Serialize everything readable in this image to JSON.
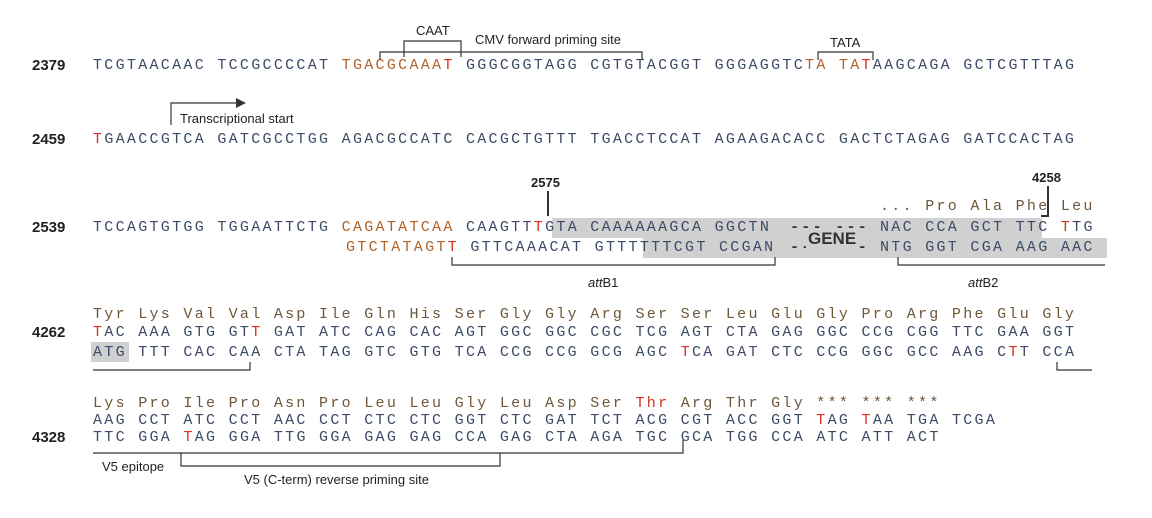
{
  "colors": {
    "blue": "#3c4a66",
    "orange": "#b0622a",
    "red": "#d7301f",
    "amino": "#6e5638",
    "highlight": "#d0d0d0"
  },
  "line_numbers": [
    "2379",
    "2459",
    "2539",
    "4262",
    "4328"
  ],
  "positions": {
    "p1": "2575",
    "p2": "4258"
  },
  "labels": {
    "caat": "CAAT",
    "cmv": "CMV forward priming site",
    "tata": "TATA",
    "tx_start": "Transcriptional start",
    "gene": "GENE",
    "gene_dashes_top": "--- ---",
    "gene_dashes_bottom": "--- ---",
    "attb1_italic": "att",
    "attb1_rest": "B1",
    "attb2_italic": "att",
    "attb2_rest": "B2",
    "v5": "V5 epitope",
    "v5_rev": "V5 (C-term) reverse priming site"
  },
  "rows": [
    {
      "id": "r2379",
      "segs": [
        [
          "b",
          "TCGTAACAAC TCCGCCCCAT "
        ],
        [
          "o",
          "TGACGCAAA"
        ],
        [
          "r",
          "T"
        ],
        [
          "b",
          " GGGCGGTAGG CGTGTACGGT GGGAGGTC"
        ],
        [
          "o",
          "TA TA"
        ],
        [
          "r",
          "T"
        ],
        [
          "b",
          "AAGCAGA GCTCGTTTAG"
        ]
      ]
    },
    {
      "id": "r2459",
      "segs": [
        [
          "r",
          "T"
        ],
        [
          "b",
          "GAACCGTCA GATCGCCTGG AGACGCCATC CACGCTGTTT TGACCTCCAT AGAAGACACC GACTCTAGAG GATCCACTAG"
        ]
      ]
    },
    {
      "id": "r2539top",
      "segs": [
        [
          "b",
          "TCCAGTGTGG TGGAATTCTG "
        ],
        [
          "o",
          "CAGATATCAA"
        ],
        [
          "b",
          " CAAGTT"
        ],
        [
          "r",
          "T"
        ],
        [
          "b",
          "GTA CAAAAAAGCA GGCTN"
        ]
      ]
    },
    {
      "id": "r2539bot",
      "segs": [
        [
          "o",
          "GTCTATAGT"
        ],
        [
          "r",
          "T"
        ],
        [
          "b",
          " GTTCAAACAT GTTTTTTCGT CCGAN"
        ]
      ]
    },
    {
      "id": "r2539aa",
      "segs": [
        [
          "a",
          "... Pro Ala Phe Leu"
        ]
      ]
    },
    {
      "id": "r2539topR",
      "segs": [
        [
          "b",
          "NAC CCA GCT TTC "
        ],
        [
          "r",
          "T"
        ],
        [
          "b",
          "TG"
        ]
      ]
    },
    {
      "id": "r2539botR",
      "segs": [
        [
          "b",
          "NTG GGT CGA AAG AAC"
        ]
      ]
    },
    {
      "id": "r4262aa",
      "segs": [
        [
          "a",
          "Tyr Lys Val Val Asp Ile Gln His Ser Gly Gly Arg Ser Ser Leu Glu Gly Pro Arg Phe Glu Gly"
        ]
      ]
    },
    {
      "id": "r4262top",
      "segs": [
        [
          "r",
          "T"
        ],
        [
          "b",
          "AC AAA GTG GT"
        ],
        [
          "r",
          "T"
        ],
        [
          "b",
          " GAT ATC CAG CAC AGT GGC GGC CGC TCG AGT CTA GAG GGC CCG CGG TTC GAA GGT"
        ]
      ]
    },
    {
      "id": "r4262bot",
      "segs": [
        [
          "b",
          "ATG TTT CAC CAA CTA TAG GTC GTG TCA CCG CCG GCG AGC "
        ],
        [
          "r",
          "T"
        ],
        [
          "b",
          "CA GAT CTC CCG GGC GCC AAG C"
        ],
        [
          "r",
          "T"
        ],
        [
          "b",
          "T CCA"
        ]
      ]
    },
    {
      "id": "r4328aa",
      "segs": [
        [
          "a",
          "Lys Pro Ile Pro Asn Pro Leu Leu Gly Leu Asp Ser "
        ],
        [
          "r",
          "Thr"
        ],
        [
          "a",
          " Arg Thr Gly *** *** ***"
        ]
      ]
    },
    {
      "id": "r4328top",
      "segs": [
        [
          "b",
          "AAG CCT ATC CCT AAC CCT CTC CTC GGT CTC GAT TCT ACG CGT ACC GGT "
        ],
        [
          "r",
          "T"
        ],
        [
          "b",
          "AG "
        ],
        [
          "r",
          "T"
        ],
        [
          "b",
          "AA TGA TCGA"
        ]
      ]
    },
    {
      "id": "r4328bot",
      "segs": [
        [
          "b",
          "TTC GGA "
        ],
        [
          "r",
          "T"
        ],
        [
          "b",
          "AG GGA TTG GGA GAG GAG CCA GAG CTA AGA TGC GCA TGG CCA ATC ATT ACT"
        ]
      ]
    }
  ]
}
